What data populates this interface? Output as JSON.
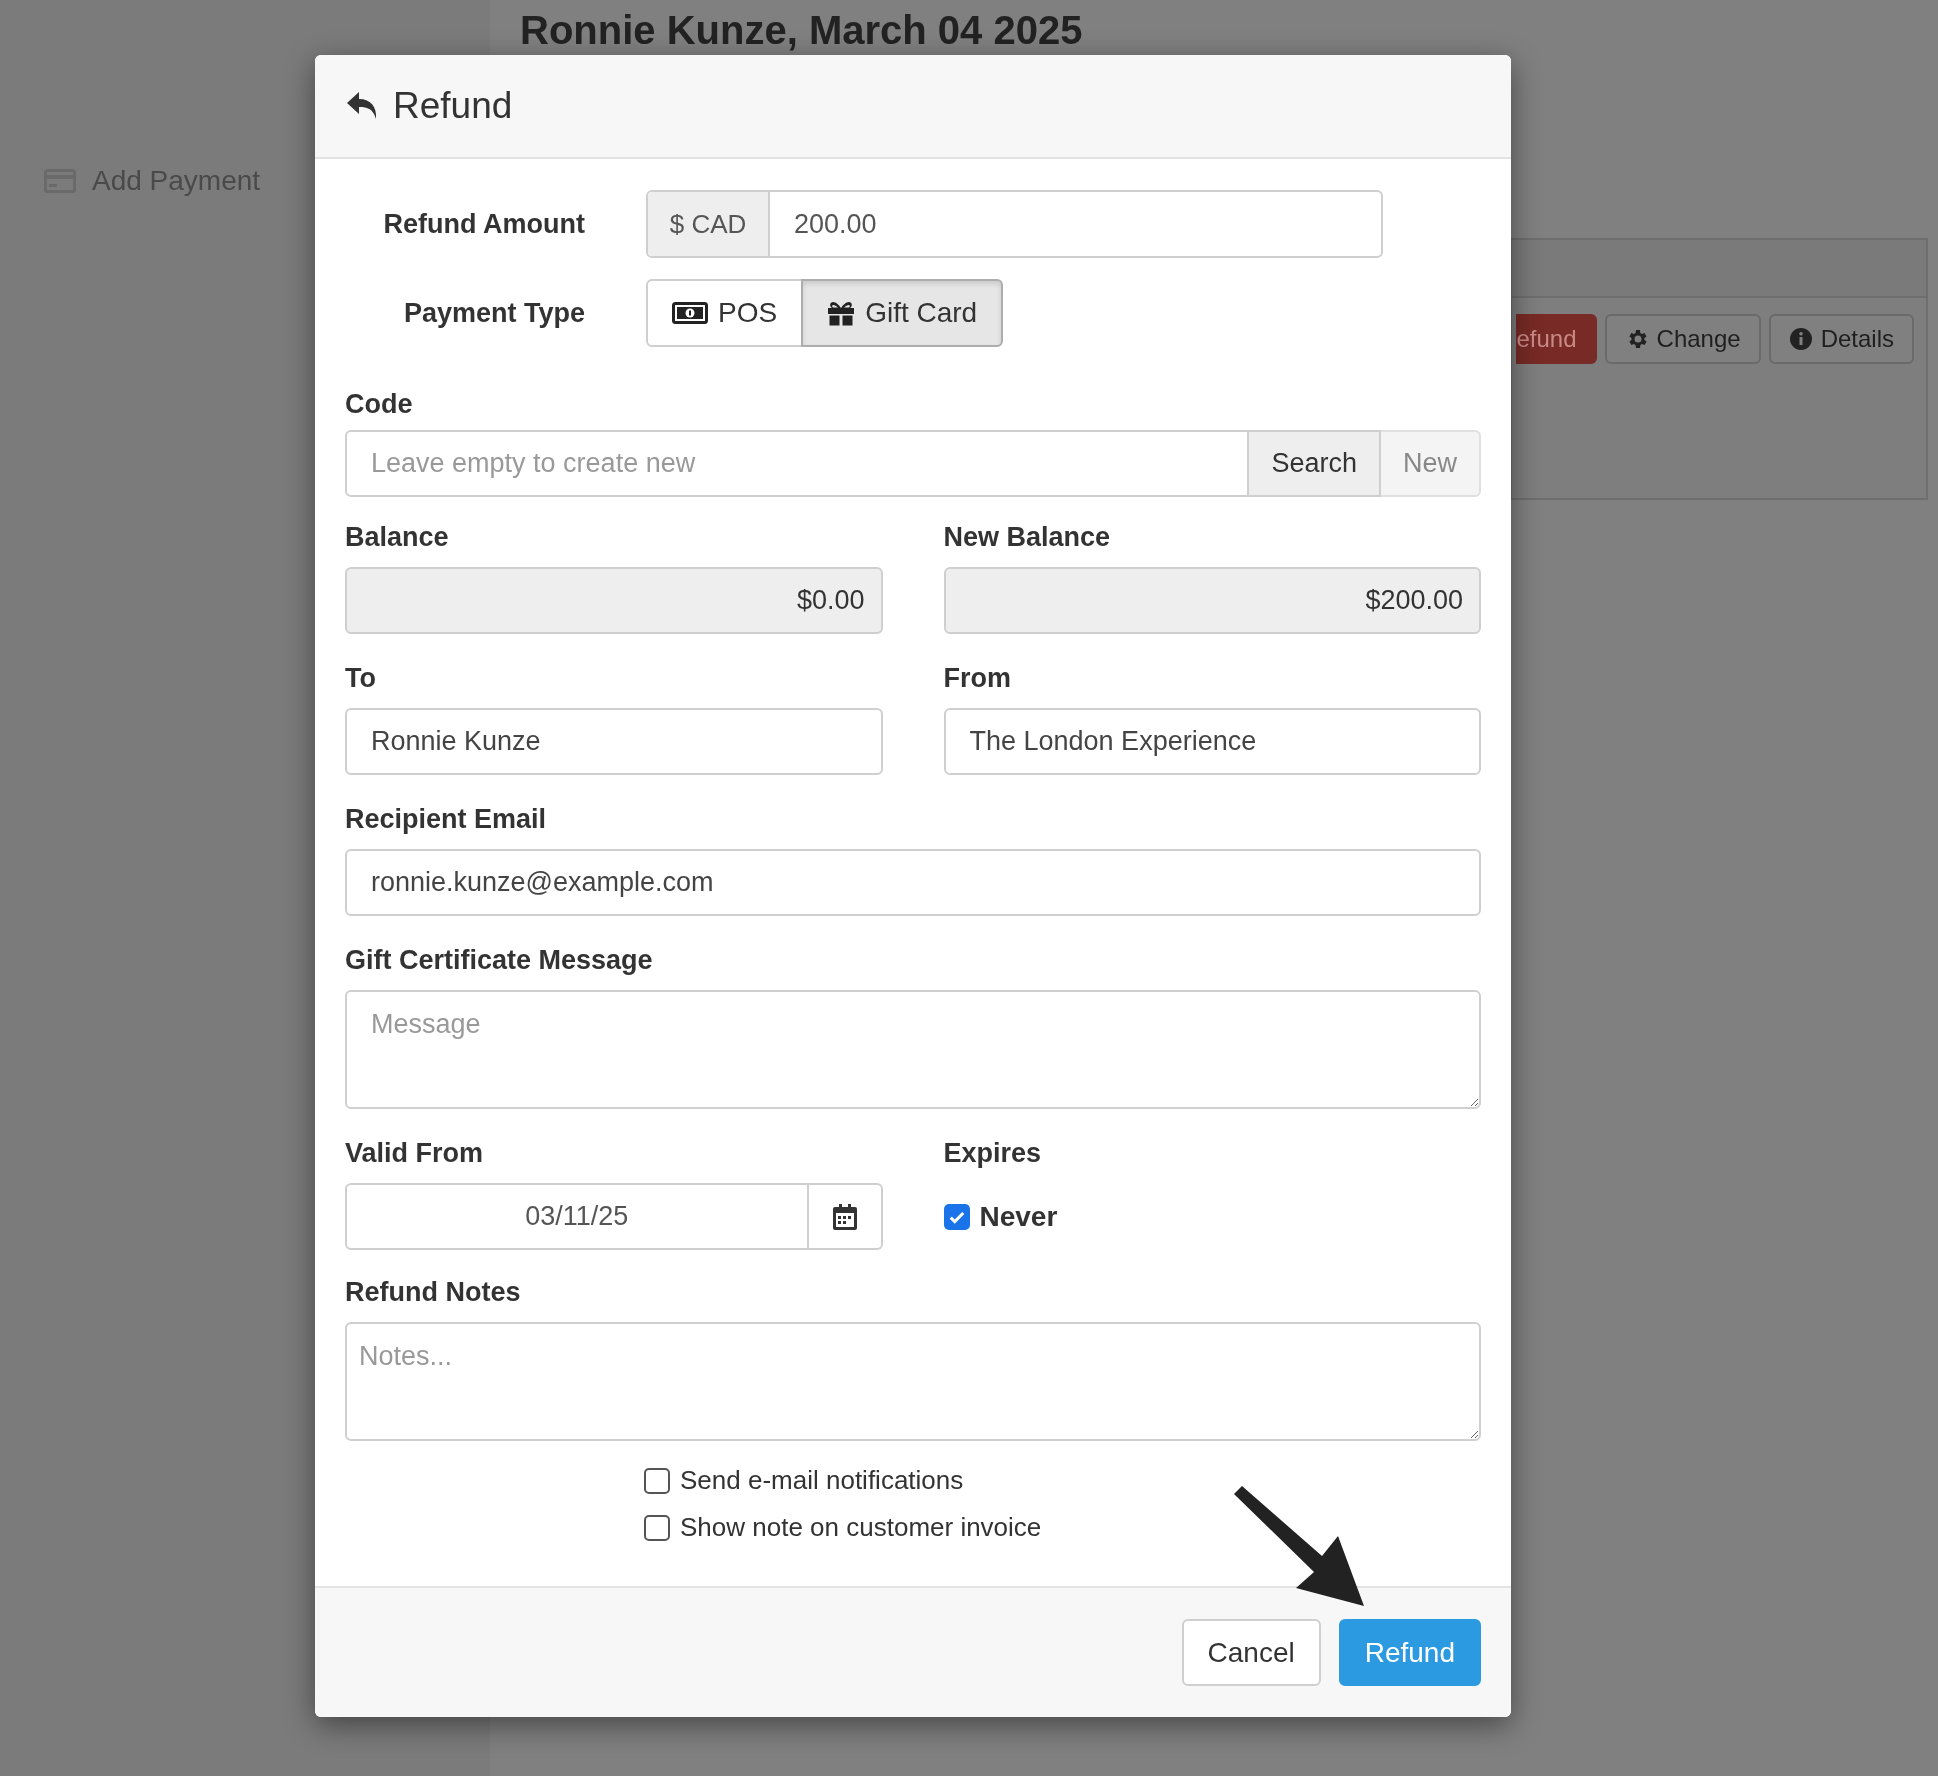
{
  "page": {
    "title": "Ronnie Kunze, March 04 2025",
    "sidebar_link": "Add Payment",
    "actions": [
      {
        "label": "efund",
        "kind": "danger"
      },
      {
        "label": "Change",
        "kind": "gear"
      },
      {
        "label": "Details",
        "kind": "info"
      }
    ]
  },
  "modal": {
    "title": "Refund",
    "refund_amount": {
      "label": "Refund Amount",
      "currency": "$ CAD",
      "value": "200.00"
    },
    "payment_type": {
      "label": "Payment Type",
      "options": [
        {
          "label": "POS",
          "kind": "cash",
          "selected": false
        },
        {
          "label": "Gift Card",
          "kind": "gift",
          "selected": true
        }
      ]
    },
    "code": {
      "label": "Code",
      "placeholder": "Leave empty to create new",
      "buttons": [
        {
          "label": "Search",
          "disabled": false
        },
        {
          "label": "New",
          "disabled": true
        }
      ]
    },
    "balance": {
      "label": "Balance",
      "value": "$0.00"
    },
    "new_balance": {
      "label": "New Balance",
      "value": "$200.00"
    },
    "to": {
      "label": "To",
      "value": "Ronnie Kunze"
    },
    "from": {
      "label": "From",
      "value": "The London Experience"
    },
    "recipient_email": {
      "label": "Recipient Email",
      "value": "ronnie.kunze@example.com"
    },
    "message": {
      "label": "Gift Certificate Message",
      "placeholder": "Message"
    },
    "valid_from": {
      "label": "Valid From",
      "value": "03/11/25"
    },
    "expires": {
      "label": "Expires",
      "option": "Never",
      "checked": true
    },
    "notes": {
      "label": "Refund Notes",
      "placeholder": "Notes..."
    },
    "options": [
      {
        "label": "Send e-mail notifications",
        "checked": false
      },
      {
        "label": "Show note on customer invoice",
        "checked": false
      }
    ],
    "buttons": [
      {
        "label": "Cancel",
        "kind": "default"
      },
      {
        "label": "Refund",
        "kind": "primary"
      }
    ]
  }
}
